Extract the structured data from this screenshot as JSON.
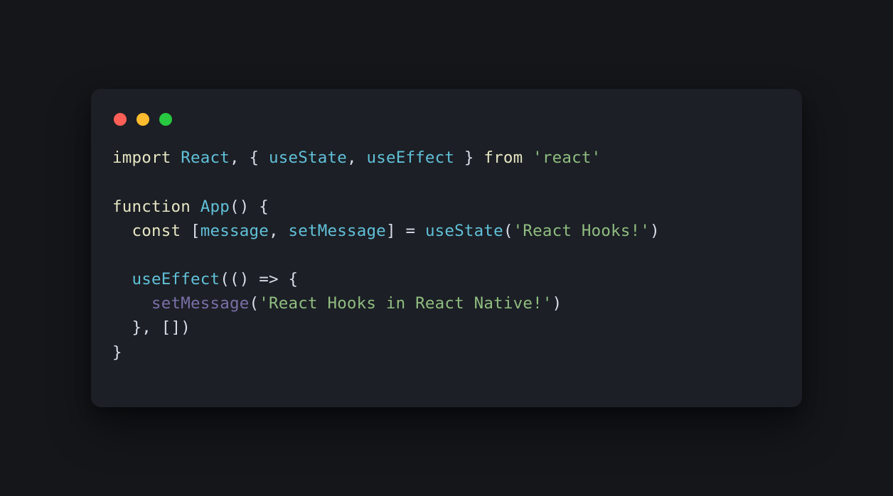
{
  "window": {
    "buttons": {
      "close": "close",
      "minimize": "minimize",
      "maximize": "maximize"
    }
  },
  "code": {
    "l1": {
      "import": "import",
      "react": "React",
      "comma1": ",",
      "lbrace": "{",
      "useState": "useState",
      "comma2": ",",
      "useEffect": "useEffect",
      "rbrace": "}",
      "from": "from",
      "module": "'react'"
    },
    "l3": {
      "function": "function",
      "name": "App",
      "parens": "()",
      "lbrace": "{"
    },
    "l4": {
      "const": "const",
      "lbracket": "[",
      "msg": "message",
      "comma": ",",
      "setMsg": "setMessage",
      "rbracket": "]",
      "eq": "=",
      "useState": "useState",
      "lp": "(",
      "str": "'React Hooks!'",
      "rp": ")"
    },
    "l6": {
      "useEffect": "useEffect",
      "open": "(()",
      "arrow": "=>",
      "lbrace": "{"
    },
    "l7": {
      "setMessage": "setMessage",
      "lp": "(",
      "str": "'React Hooks in React Native!'",
      "rp": ")"
    },
    "l8": {
      "rbrace": "}",
      "comma": ",",
      "arr": "[]",
      "rp": ")"
    },
    "l9": {
      "rbrace": "}"
    }
  }
}
